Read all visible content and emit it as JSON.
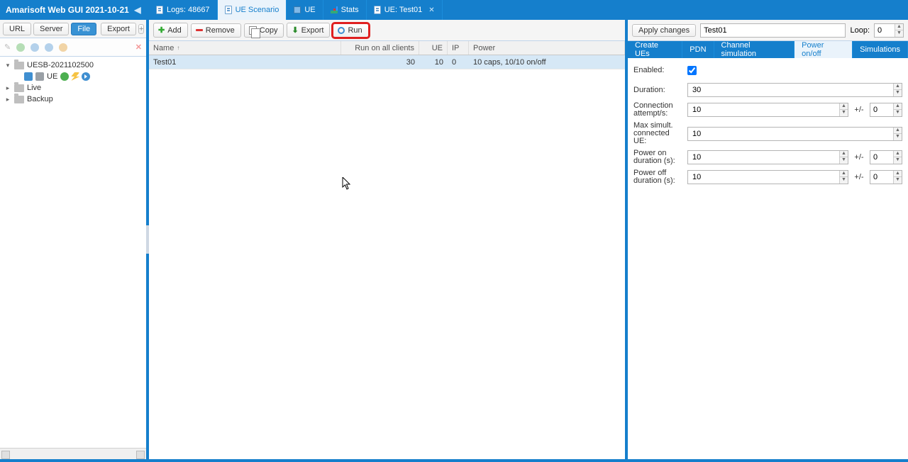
{
  "brand": {
    "title": "Amarisoft Web GUI 2021-10-21"
  },
  "tabs": [
    {
      "label": "Logs: 48667",
      "closable": false
    },
    {
      "label": "UE Scenario",
      "closable": false,
      "active": true
    },
    {
      "label": "UE",
      "closable": false
    },
    {
      "label": "Stats",
      "closable": false
    },
    {
      "label": "UE: Test01",
      "closable": true
    }
  ],
  "left_toolbar": {
    "url": "URL",
    "server": "Server",
    "file": "File",
    "export": "Export"
  },
  "tree": {
    "root": {
      "label": "UESB-2021102500"
    },
    "ue": {
      "label": "UE"
    },
    "live": {
      "label": "Live"
    },
    "backup": {
      "label": "Backup"
    }
  },
  "center_toolbar": {
    "add": "Add",
    "remove": "Remove",
    "copy": "Copy",
    "export": "Export",
    "run": "Run"
  },
  "grid": {
    "headers": {
      "name": "Name",
      "rac": "Run on all clients",
      "ue": "UE",
      "ip": "IP",
      "power": "Power"
    },
    "rows": [
      {
        "name": "Test01",
        "rac": "30",
        "ue": "10",
        "ip": "0",
        "power": "10 caps, 10/10 on/off"
      }
    ]
  },
  "right": {
    "apply": "Apply changes",
    "name_value": "Test01",
    "loop_label": "Loop:",
    "loop_value": "0",
    "tabs": [
      "Create UEs",
      "PDN",
      "Channel simulation",
      "Power on/off",
      "Simulations"
    ],
    "active_tab": 3,
    "form": {
      "enabled_label": "Enabled:",
      "enabled": true,
      "duration_label": "Duration:",
      "duration": "30",
      "conn_label": "Connection attempt/s:",
      "conn": "10",
      "conn_pm": "0",
      "max_label": "Max simult. connected UE:",
      "max": "10",
      "pon_label": "Power on duration (s):",
      "pon": "10",
      "pon_pm": "0",
      "poff_label": "Power off duration (s):",
      "poff": "10",
      "poff_pm": "0",
      "pm_symbol": "+/-"
    }
  }
}
